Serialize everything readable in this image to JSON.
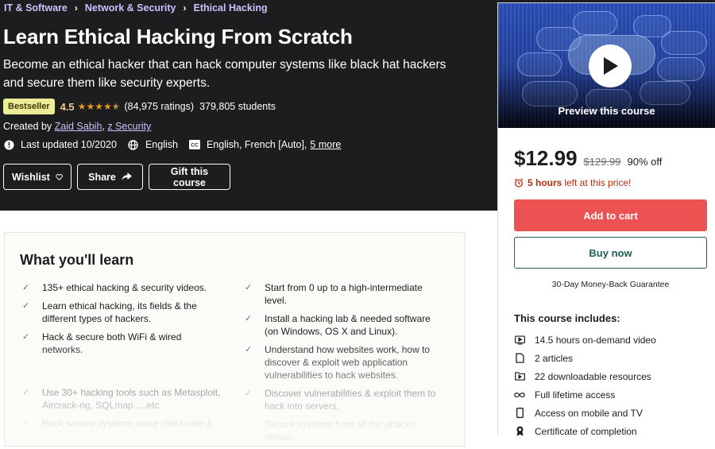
{
  "breadcrumb": [
    {
      "label": "IT & Software"
    },
    {
      "label": "Network & Security"
    },
    {
      "label": "Ethical Hacking"
    }
  ],
  "course": {
    "title": "Learn Ethical Hacking From Scratch",
    "subtitle": "Become an ethical hacker that can hack computer systems like black hat hackers and secure them like security experts.",
    "badge": "Bestseller",
    "rating": "4.5",
    "rating_value": 4.5,
    "rating_max": 5,
    "ratings_count": "(84,975 ratings)",
    "students": "379,805 students",
    "created_by_label": "Created by",
    "authors": [
      "Zaid Sabih",
      "z Security"
    ],
    "last_updated": "Last updated 10/2020",
    "language": "English",
    "captions": "English, French [Auto],",
    "captions_more": "5 more"
  },
  "actions": {
    "wishlist": "Wishlist",
    "share": "Share",
    "gift": "Gift this course"
  },
  "learn": {
    "title": "What you'll learn",
    "left": [
      "135+ ethical hacking & security videos.",
      "Learn ethical hacking, its fields & the different types of hackers.",
      "Hack & secure both WiFi & wired networks.",
      "Use 30+ hacking tools such as Metasploit, Aircrack-ng, SQLmap.....etc.",
      "Hack secure systems using client-side &"
    ],
    "right": [
      "Start from 0 up to a high-intermediate level.",
      "Install a hacking lab & needed software (on Windows, OS X and Linux).",
      "Understand how websites work, how to discover & exploit web application vulnerabilities to hack websites.",
      "Discover vulnerabilities & exploit them to hack into servers.",
      "Secure systems from all the attacks shown"
    ]
  },
  "sidebar": {
    "preview_label": "Preview this course",
    "price": "$12.99",
    "original_price": "$129.99",
    "discount": "90% off",
    "timer_bold": "5 hours",
    "timer_rest": "left at this price!",
    "add_to_cart": "Add to cart",
    "buy_now": "Buy now",
    "guarantee": "30-Day Money-Back Guarantee",
    "includes_title": "This course includes:",
    "includes": [
      {
        "icon": "video-icon",
        "label": "14.5 hours on-demand video"
      },
      {
        "icon": "file-icon",
        "label": "2 articles"
      },
      {
        "icon": "download-folder-icon",
        "label": "22 downloadable resources"
      },
      {
        "icon": "infinity-icon",
        "label": "Full lifetime access"
      },
      {
        "icon": "mobile-icon",
        "label": "Access on mobile and TV"
      },
      {
        "icon": "certificate-icon",
        "label": "Certificate of completion"
      }
    ]
  },
  "colors": {
    "header_bg": "#1c1d1f",
    "link_purple": "#cec0fc",
    "badge_bg": "#eceb98",
    "star": "#e59819",
    "cart_red": "#ec5252",
    "buy_teal": "#1e6055",
    "timer_red": "#b32d0f"
  }
}
